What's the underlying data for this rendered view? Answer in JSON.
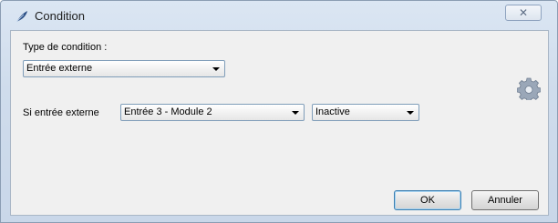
{
  "window": {
    "title": "Condition",
    "close_glyph": "✕"
  },
  "condition_type": {
    "label": "Type de condition :",
    "selected": "Entrée externe"
  },
  "external_input": {
    "label": "Si entrée externe",
    "input_selected": "Entrée 3 - Module 2",
    "state_selected": "Inactive"
  },
  "buttons": {
    "ok": "OK",
    "cancel": "Annuler"
  },
  "icons": {
    "title": "feather-icon",
    "settings": "gear-icon"
  }
}
